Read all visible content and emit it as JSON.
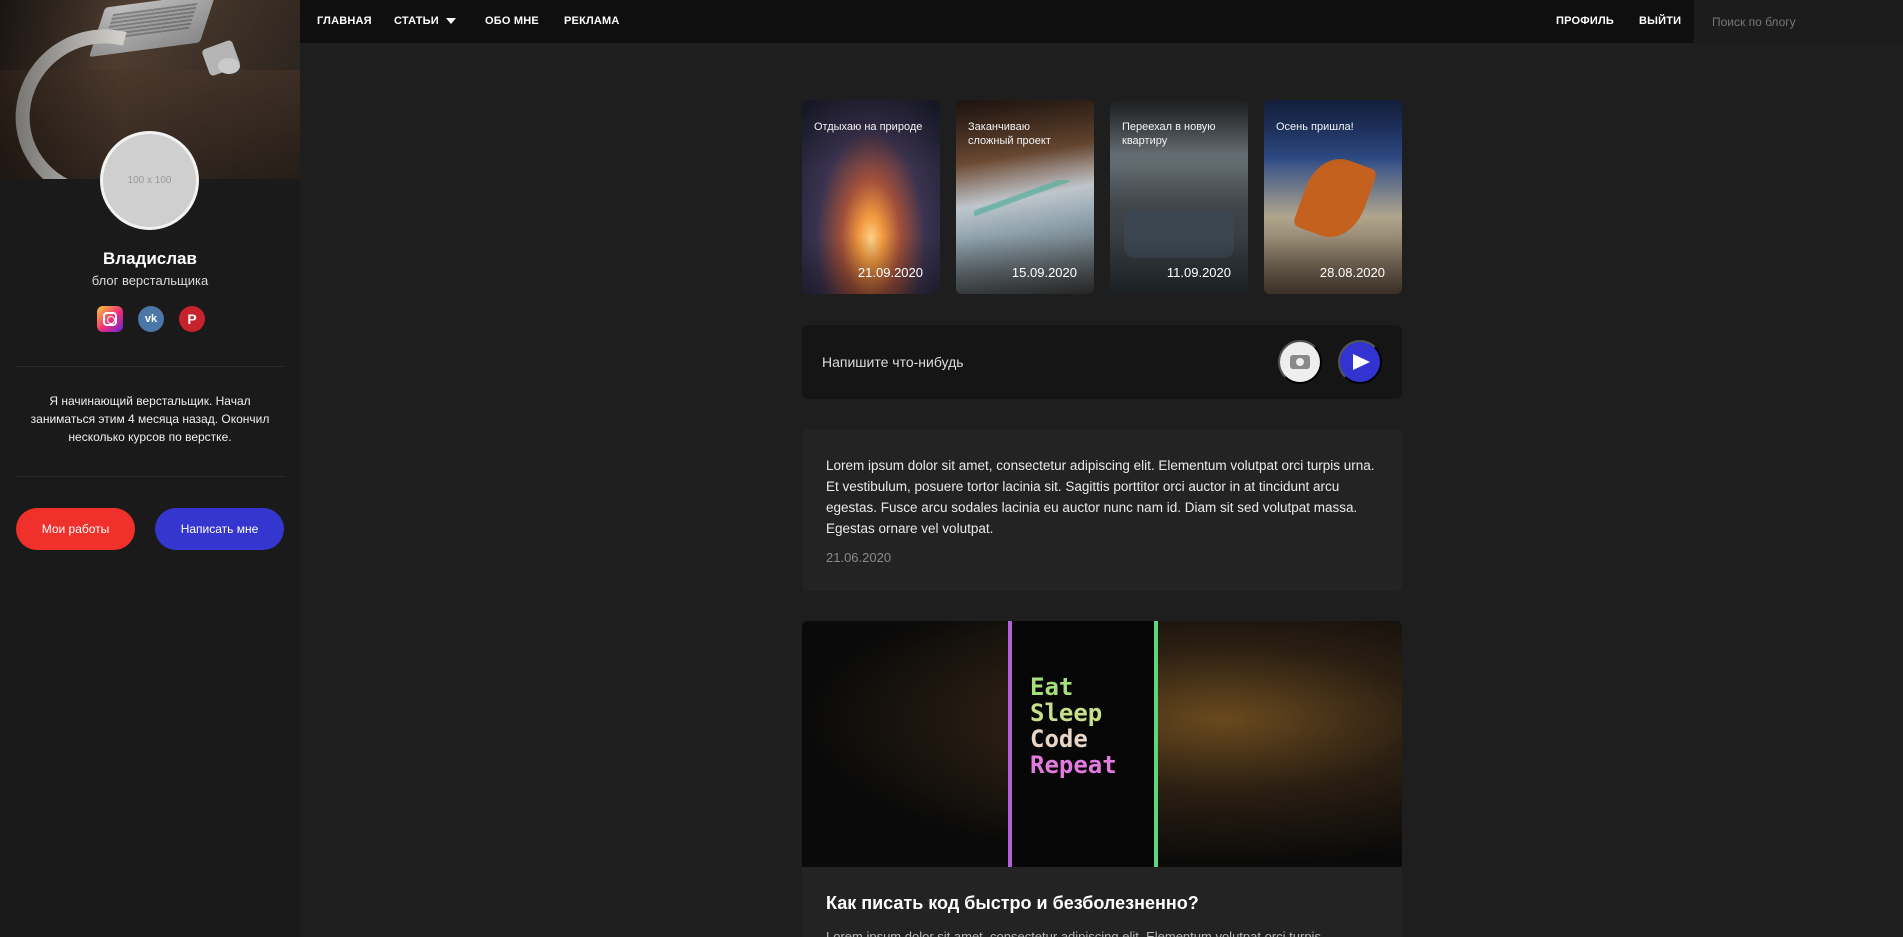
{
  "nav": {
    "links": [
      "ГЛАВНАЯ",
      "СТАТЬИ",
      "ОБО МНЕ",
      "РЕКЛАМА"
    ],
    "right": [
      "ПРОФИЛЬ",
      "ВЫЙТИ"
    ],
    "search_placeholder": "Поиск по блогу"
  },
  "sidebar": {
    "avatar_placeholder": "100 x 100",
    "name": "Владислав",
    "subtitle": "блог верстальщика",
    "socials": [
      "instagram-icon",
      "vk-icon",
      "pinterest-icon"
    ],
    "about": "Я начинающий верстальщик. Начал заниматься этим 4 месяца назад. Окончил несколько курсов по верстке.",
    "btn_works": "Мои работы",
    "btn_write": "Написать мне",
    "colors": {
      "red": "#f0302a",
      "blue": "#3535d0"
    }
  },
  "stories": [
    {
      "caption": "Отдыхаю на природе",
      "date": "21.09.2020"
    },
    {
      "caption": "Заканчиваю сложный проект",
      "date": "15.09.2020"
    },
    {
      "caption": "Переехал в новую квартиру",
      "date": "11.09.2020"
    },
    {
      "caption": "Осень пришла!",
      "date": "28.08.2020"
    }
  ],
  "composer": {
    "placeholder": "Напишите что-нибудь"
  },
  "posts": [
    {
      "text": "Lorem ipsum dolor sit amet, consectetur adipiscing elit. Elementum volutpat orci turpis urna. Et vestibulum, posuere tortor lacinia sit. Sagittis porttitor orci auctor in at tincidunt arcu egestas. Fusce arcu sodales lacinia eu auctor nunc nam id. Diam sit sed volutpat massa. Egestas ornare vel volutpat.",
      "date": "21.06.2020"
    },
    {
      "image_text": [
        "Eat",
        "Sleep",
        "Code",
        "Repeat"
      ],
      "title": "Как писать код быстро и безболезненно?",
      "snippet": "Lorem ipsum dolor sit amet, consectetur adipiscing elit. Elementum volutpat orci turpis"
    }
  ]
}
